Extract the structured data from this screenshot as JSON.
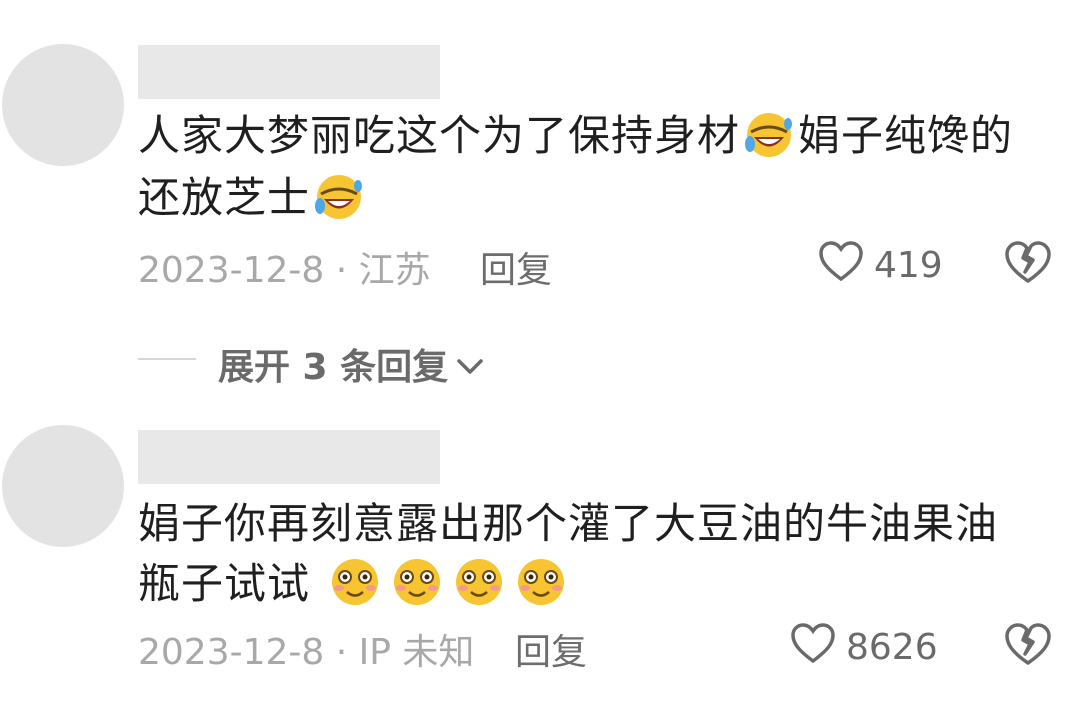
{
  "comments": [
    {
      "text_line1": "人家大梦丽吃这个为了保持身材",
      "text_line1b": "娟子纯馋的",
      "text_line2": "还放芝士",
      "meta": "2023-12-8 · 江苏",
      "reply_label": "回复",
      "likes": "419",
      "emojis": [
        "laughing-crying-emoji"
      ]
    },
    {
      "text_line1": "娟子你再刻意露出那个灌了大豆油的牛油果油",
      "text_line2": "瓶子试试",
      "meta": "2023-12-8 · IP 未知",
      "reply_label": "回复",
      "likes": "8626",
      "emojis": [
        "shy-smile-emoji"
      ]
    }
  ],
  "expand_replies": "展开 3 条回复",
  "icons": {
    "like": "heart-outline-icon",
    "dislike": "broken-heart-icon",
    "expand": "chevron-down-icon"
  }
}
